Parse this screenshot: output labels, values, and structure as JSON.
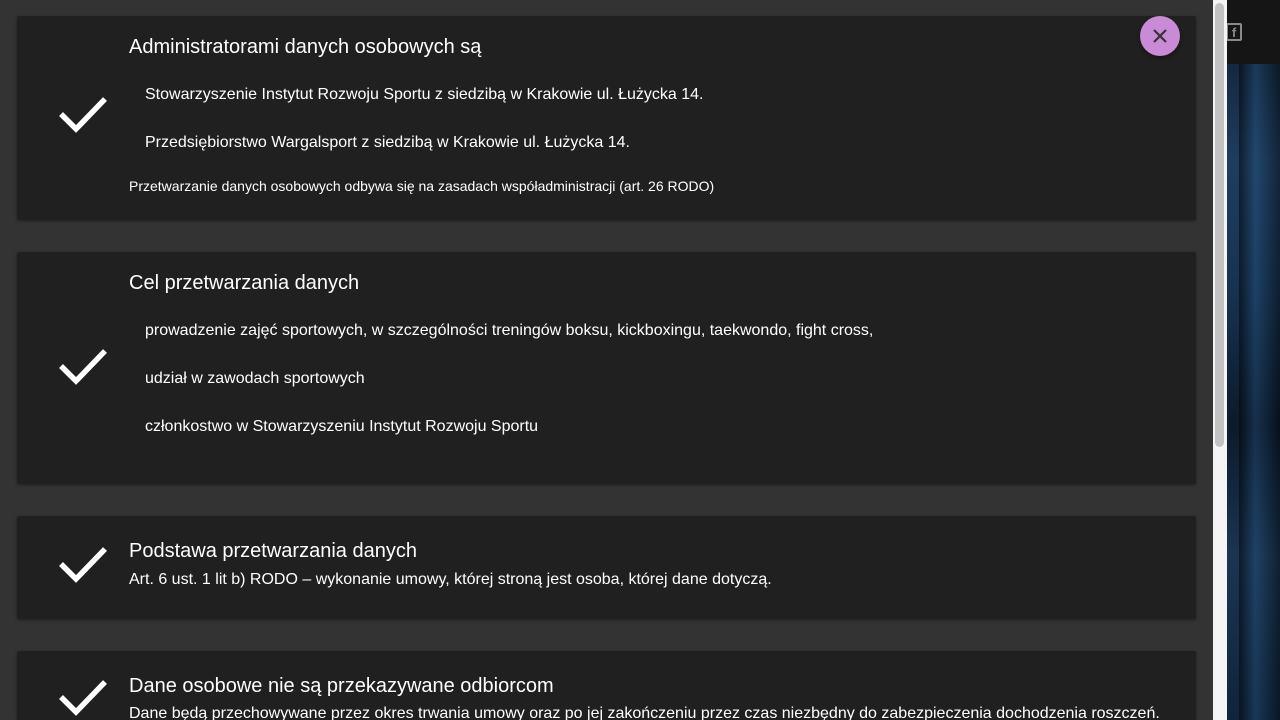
{
  "close_button": {
    "icon": "close-icon",
    "color": "#c98ad6"
  },
  "social": {
    "icon": "facebook-icon"
  },
  "sections": {
    "administrators": {
      "title": "Administratorami danych osobowych są",
      "items": [
        "Stowarzyszenie Instytut Rozwoju Sportu z siedzibą w Krakowie ul. Łużycka 14.",
        "Przedsiębiorstwo Wargalsport z siedzibą w Krakowie ul. Łużycka 14."
      ],
      "note": "Przetwarzanie danych osobowych odbywa się na zasadach współadministracji (art. 26 RODO)"
    },
    "purpose": {
      "title": "Cel przetwarzania danych",
      "items": [
        "prowadzenie zajęć sportowych, w szczególności treningów boksu, kickboxingu, taekwondo, fight cross,",
        "udział w zawodach sportowych",
        "członkostwo w Stowarzyszeniu Instytut Rozwoju Sportu"
      ]
    },
    "legal_basis": {
      "title": "Podstawa przetwarzania danych",
      "text": "Art. 6 ust. 1 lit b) RODO – wykonanie umowy, której stroną jest osoba, której dane dotyczą."
    },
    "recipients": {
      "title": "Dane osobowe nie są przekazywane odbiorcom",
      "text": "Dane będą przechowywane przez okres trwania umowy oraz po jej zakończeniu przez czas niezbędny do zabezpieczenia dochodzenia roszczeń."
    }
  }
}
